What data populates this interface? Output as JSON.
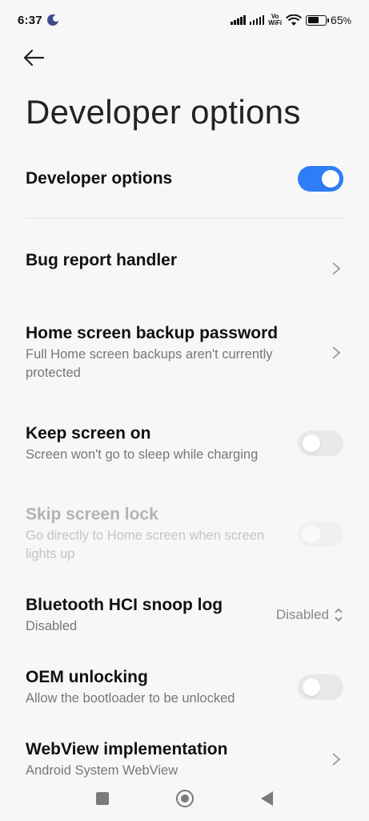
{
  "status_bar": {
    "time": "6:37",
    "vowifi_top": "Vo",
    "vowifi_bottom": "WiFi",
    "battery_percent": "65",
    "battery_level": 0.65
  },
  "header": {
    "title": "Developer options"
  },
  "master_toggle": {
    "label": "Developer options",
    "on": true
  },
  "settings": [
    {
      "title": "Bug report handler",
      "control": "chevron"
    },
    {
      "title": "Home screen backup password",
      "subtitle": "Full Home screen backups aren't currently protected",
      "control": "chevron"
    },
    {
      "title": "Keep screen on",
      "subtitle": "Screen won't go to sleep while charging",
      "control": "toggle",
      "on": false
    },
    {
      "title": "Skip screen lock",
      "subtitle": "Go directly to Home screen when screen lights up",
      "control": "toggle",
      "on": false,
      "disabled": true
    },
    {
      "title": "Bluetooth HCI snoop log",
      "subtitle": "Disabled",
      "control": "select",
      "value": "Disabled"
    },
    {
      "title": "OEM unlocking",
      "subtitle": "Allow the bootloader to be unlocked",
      "control": "toggle",
      "on": false
    },
    {
      "title": "WebView implementation",
      "subtitle": "Android System WebView",
      "control": "chevron"
    }
  ],
  "colors": {
    "accent": "#2f7df6",
    "background": "#f7f7f7",
    "text_primary": "#111111",
    "text_secondary": "#777777"
  },
  "icons": [
    "back-arrow-icon",
    "chevron-right-icon",
    "select-arrows-icon",
    "wifi-icon",
    "signal-icon",
    "battery-icon"
  ]
}
